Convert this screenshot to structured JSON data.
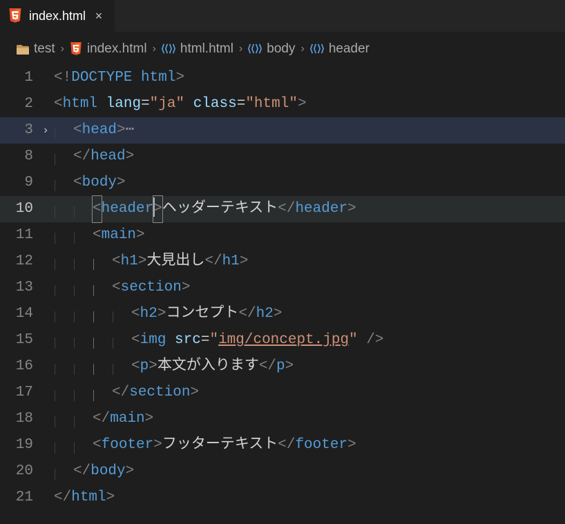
{
  "tab": {
    "title": "index.html",
    "close_glyph": "×"
  },
  "breadcrumb": {
    "items": [
      {
        "icon": "folder",
        "label": "test"
      },
      {
        "icon": "html5",
        "label": "index.html"
      },
      {
        "icon": "symbol",
        "label": "html.html"
      },
      {
        "icon": "symbol",
        "label": "body"
      },
      {
        "icon": "symbol",
        "label": "header"
      }
    ],
    "sep_glyph": "›"
  },
  "lines": {
    "n1": "1",
    "n2": "2",
    "n3": "3",
    "n8": "8",
    "n9": "9",
    "n10": "10",
    "n11": "11",
    "n12": "12",
    "n13": "13",
    "n14": "14",
    "n15": "15",
    "n16": "16",
    "n17": "17",
    "n18": "18",
    "n19": "19",
    "n20": "20",
    "n21": "21"
  },
  "fold": {
    "collapsed_glyph": "›",
    "ellipsis": "⋯"
  },
  "code": {
    "l1": {
      "a": "<!",
      "b": "DOCTYPE",
      "c": " ",
      "d": "html",
      "e": ">"
    },
    "l2": {
      "open": "<",
      "tag": "html",
      "sp": " ",
      "a1": "lang",
      "eq1": "=",
      "v1": "\"ja\"",
      "sp2": " ",
      "a2": "class",
      "eq2": "=",
      "v2": "\"html\"",
      "close": ">"
    },
    "l3": {
      "open": "<",
      "tag": "head",
      "close": ">"
    },
    "l8": {
      "open": "</",
      "tag": "head",
      "close": ">"
    },
    "l9": {
      "open": "<",
      "tag": "body",
      "close": ">"
    },
    "l10": {
      "open1": "<",
      "tag1": "header",
      "close1": ">",
      "text": "ヘッダーテキスト",
      "open2": "</",
      "tag2": "header",
      "close2": ">"
    },
    "l11": {
      "open": "<",
      "tag": "main",
      "close": ">"
    },
    "l12": {
      "open1": "<",
      "tag1": "h1",
      "close1": ">",
      "text": "大見出し",
      "open2": "</",
      "tag2": "h1",
      "close2": ">"
    },
    "l13": {
      "open": "<",
      "tag": "section",
      "close": ">"
    },
    "l14": {
      "open1": "<",
      "tag1": "h2",
      "close1": ">",
      "text": "コンセプト",
      "open2": "</",
      "tag2": "h2",
      "close2": ">"
    },
    "l15": {
      "open": "<",
      "tag": "img",
      "sp": " ",
      "attr": "src",
      "eq": "=",
      "q1": "\"",
      "link": "img/concept.jpg",
      "q2": "\"",
      "sp2": " ",
      "close": "/>"
    },
    "l16": {
      "open1": "<",
      "tag1": "p",
      "close1": ">",
      "text": "本文が入ります",
      "open2": "</",
      "tag2": "p",
      "close2": ">"
    },
    "l17": {
      "open": "</",
      "tag": "section",
      "close": ">"
    },
    "l18": {
      "open": "</",
      "tag": "main",
      "close": ">"
    },
    "l19": {
      "open1": "<",
      "tag1": "footer",
      "close1": ">",
      "text": "フッターテキスト",
      "open2": "</",
      "tag2": "footer",
      "close2": ">"
    },
    "l20": {
      "open": "</",
      "tag": "body",
      "close": ">"
    },
    "l21": {
      "open": "</",
      "tag": "html",
      "close": ">"
    }
  }
}
